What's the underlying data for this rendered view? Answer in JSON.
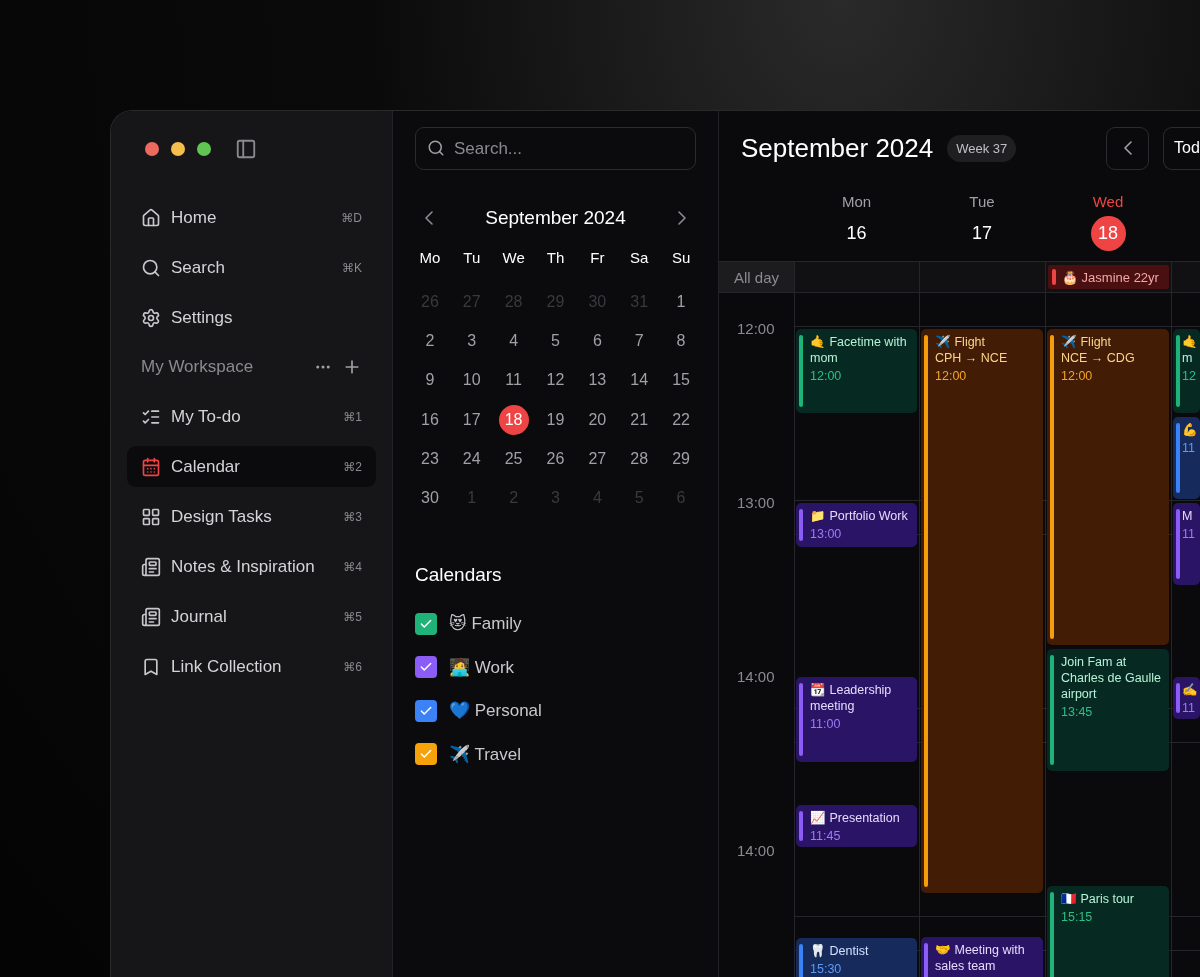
{
  "sidebar": {
    "nav": [
      {
        "kind": "home",
        "label": "Home",
        "shortcut": "⌘D",
        "selected": false
      },
      {
        "kind": "search",
        "label": "Search",
        "shortcut": "⌘K",
        "selected": false
      },
      {
        "kind": "settings",
        "label": "Settings",
        "selected": false
      }
    ],
    "workspace": {
      "title": "My Workspace",
      "items": [
        {
          "kind": "todo",
          "label": "My To-do",
          "shortcut": "⌘1",
          "selected": false
        },
        {
          "kind": "calendar",
          "label": "Calendar",
          "shortcut": "⌘2",
          "selected": true
        },
        {
          "kind": "board",
          "label": "Design Tasks",
          "shortcut": "⌘3",
          "selected": false
        },
        {
          "kind": "notes",
          "label": "Notes & Inspiration",
          "shortcut": "⌘4",
          "selected": false
        },
        {
          "kind": "notes",
          "label": "Journal",
          "shortcut": "⌘5",
          "selected": false
        },
        {
          "kind": "bookmark",
          "label": "Link Collection",
          "shortcut": "⌘6",
          "selected": false
        }
      ]
    }
  },
  "search": {
    "placeholder": "Search..."
  },
  "mini_calendar": {
    "title": "September 2024",
    "weekdays": [
      "Mo",
      "Tu",
      "We",
      "Th",
      "Fr",
      "Sa",
      "Su"
    ],
    "days": [
      {
        "label": "26",
        "outside": true,
        "selected": false
      },
      {
        "label": "27",
        "outside": true,
        "selected": false
      },
      {
        "label": "28",
        "outside": true,
        "selected": false
      },
      {
        "label": "29",
        "outside": true,
        "selected": false
      },
      {
        "label": "30",
        "outside": true,
        "selected": false
      },
      {
        "label": "31",
        "outside": true,
        "selected": false
      },
      {
        "label": "1",
        "outside": false,
        "selected": false
      },
      {
        "label": "2",
        "outside": false,
        "selected": false
      },
      {
        "label": "3",
        "outside": false,
        "selected": false
      },
      {
        "label": "4",
        "outside": false,
        "selected": false
      },
      {
        "label": "5",
        "outside": false,
        "selected": false
      },
      {
        "label": "6",
        "outside": false,
        "selected": false
      },
      {
        "label": "7",
        "outside": false,
        "selected": false
      },
      {
        "label": "8",
        "outside": false,
        "selected": false
      },
      {
        "label": "9",
        "outside": false,
        "selected": false
      },
      {
        "label": "10",
        "outside": false,
        "selected": false
      },
      {
        "label": "11",
        "outside": false,
        "selected": false
      },
      {
        "label": "12",
        "outside": false,
        "selected": false
      },
      {
        "label": "13",
        "outside": false,
        "selected": false
      },
      {
        "label": "14",
        "outside": false,
        "selected": false
      },
      {
        "label": "15",
        "outside": false,
        "selected": false
      },
      {
        "label": "16",
        "outside": false,
        "selected": false
      },
      {
        "label": "17",
        "outside": false,
        "selected": false
      },
      {
        "label": "18",
        "outside": false,
        "selected": true
      },
      {
        "label": "19",
        "outside": false,
        "selected": false
      },
      {
        "label": "20",
        "outside": false,
        "selected": false
      },
      {
        "label": "21",
        "outside": false,
        "selected": false
      },
      {
        "label": "22",
        "outside": false,
        "selected": false
      },
      {
        "label": "23",
        "outside": false,
        "selected": false
      },
      {
        "label": "24",
        "outside": false,
        "selected": false
      },
      {
        "label": "25",
        "outside": false,
        "selected": false
      },
      {
        "label": "26",
        "outside": false,
        "selected": false
      },
      {
        "label": "27",
        "outside": false,
        "selected": false
      },
      {
        "label": "28",
        "outside": false,
        "selected": false
      },
      {
        "label": "29",
        "outside": false,
        "selected": false
      },
      {
        "label": "30",
        "outside": false,
        "selected": false
      },
      {
        "label": "1",
        "outside": true,
        "selected": false
      },
      {
        "label": "2",
        "outside": true,
        "selected": false
      },
      {
        "label": "3",
        "outside": true,
        "selected": false
      },
      {
        "label": "4",
        "outside": true,
        "selected": false
      },
      {
        "label": "5",
        "outside": true,
        "selected": false
      },
      {
        "label": "6",
        "outside": true,
        "selected": false
      }
    ]
  },
  "calendars": {
    "title": "Calendars",
    "items": [
      {
        "label": "😻 Family",
        "checked": true,
        "color": "#1fb37a"
      },
      {
        "label": "🧑‍💻 Work",
        "checked": true,
        "color": "#8b5cf6"
      },
      {
        "label": "💙 Personal",
        "checked": true,
        "color": "#3b82f6"
      },
      {
        "label": "✈️ Travel",
        "checked": true,
        "color": "#f5a20b"
      }
    ]
  },
  "header": {
    "title": "September 2024",
    "week": "Week 37",
    "today_button": "Tod"
  },
  "all_day_label": "All day",
  "days": [
    {
      "name": "Mon",
      "date": "16",
      "selected": false
    },
    {
      "name": "Tue",
      "date": "17",
      "selected": false
    },
    {
      "name": "Wed",
      "date": "18",
      "selected": true,
      "all_day": [
        {
          "title": "🎂 Jasmine 22yr"
        }
      ]
    }
  ],
  "hours": [
    "12:00",
    "13:00",
    "14:00",
    "14:00"
  ],
  "columns": [
    [
      {
        "title": "🤙 Facetime with mom",
        "time": "12:00",
        "kind": "family"
      },
      {
        "title": "📁 Portfolio Work",
        "time": "13:00",
        "kind": "work"
      },
      {
        "title": "📆 Leadership meeting",
        "time": "11:00",
        "kind": "work"
      },
      {
        "title": "📈 Presentation",
        "time": "11:45",
        "kind": "work"
      },
      {
        "title": "🦷 Dentist",
        "time": "15:30",
        "kind": "personal"
      }
    ],
    [
      {
        "title": "✈️ Flight",
        "subtitle": "CPH → NCE",
        "time": "12:00",
        "kind": "travel"
      },
      {
        "title": "🤝 Meeting with sales team",
        "kind": "work"
      }
    ],
    [
      {
        "title": "✈️ Flight",
        "subtitle": "NCE → CDG",
        "time": "12:00",
        "kind": "travel"
      },
      {
        "title": "Join Fam at Charles de Gaulle airport",
        "time": "13:45",
        "kind": "family"
      },
      {
        "title": "🇫🇷 Paris tour",
        "time": "15:15",
        "kind": "family"
      }
    ],
    [
      {
        "title": "🤙",
        "subtitle": "m",
        "time": "12",
        "kind": "family"
      },
      {
        "title": "💪",
        "time": "11",
        "kind": "personal"
      },
      {
        "title": "M",
        "time": "11",
        "kind": "work"
      },
      {
        "title": "✍️",
        "time": "11",
        "kind": "work"
      }
    ]
  ]
}
